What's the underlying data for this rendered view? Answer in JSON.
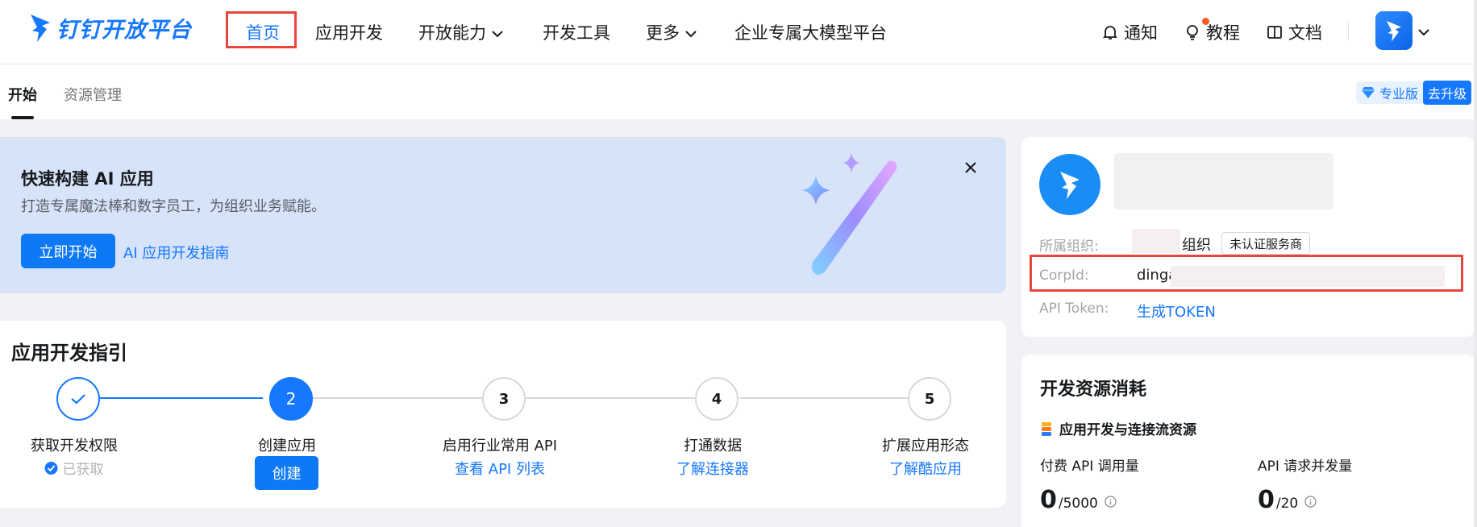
{
  "nav": {
    "brand": "钉钉开放平台",
    "items": [
      {
        "label": "首页",
        "active": true
      },
      {
        "label": "应用开发"
      },
      {
        "label": "开放能力",
        "has_dropdown": true
      },
      {
        "label": "开发工具"
      },
      {
        "label": "更多",
        "has_dropdown": true
      },
      {
        "label": "企业专属大模型平台"
      }
    ],
    "right": {
      "notify": "通知",
      "tutorial": "教程",
      "docs": "文档"
    }
  },
  "subtabs": {
    "start": "开始",
    "resources": "资源管理",
    "edition": "专业版",
    "upgrade": "去升级"
  },
  "banner": {
    "title": "快速构建 AI 应用",
    "subtitle": "打造专属魔法棒和数字员工，为组织业务赋能。",
    "cta": "立即开始",
    "link": "AI 应用开发指南"
  },
  "guide": {
    "title": "应用开发指引",
    "steps": [
      {
        "num": "",
        "label": "获取开发权限",
        "status": "已获取"
      },
      {
        "num": "2",
        "label": "创建应用",
        "action": "创建"
      },
      {
        "num": "3",
        "label": "启用行业常用 API",
        "link": "查看 API 列表"
      },
      {
        "num": "4",
        "label": "打通数据",
        "link": "了解连接器"
      },
      {
        "num": "5",
        "label": "扩展应用形态",
        "link": "了解酷应用"
      }
    ]
  },
  "org": {
    "org_label": "所属组织:",
    "org_suffix": "组织",
    "org_tag": "未认证服务商",
    "corp_label": "CorpId:",
    "corp_value": "dinga",
    "token_label": "API Token:",
    "token_link": "生成TOKEN"
  },
  "resources": {
    "title": "开发资源消耗",
    "subtitle": "应用开发与连接流资源",
    "metrics": [
      {
        "label": "付费 API 调用量",
        "value": "0",
        "limit": "/5000"
      },
      {
        "label": "API 请求并发量",
        "value": "0",
        "limit": "/20"
      }
    ]
  },
  "colors": {
    "brand": "#1677ff",
    "highlight": "#e8463d",
    "banner_bg": "#d7e3f9"
  }
}
